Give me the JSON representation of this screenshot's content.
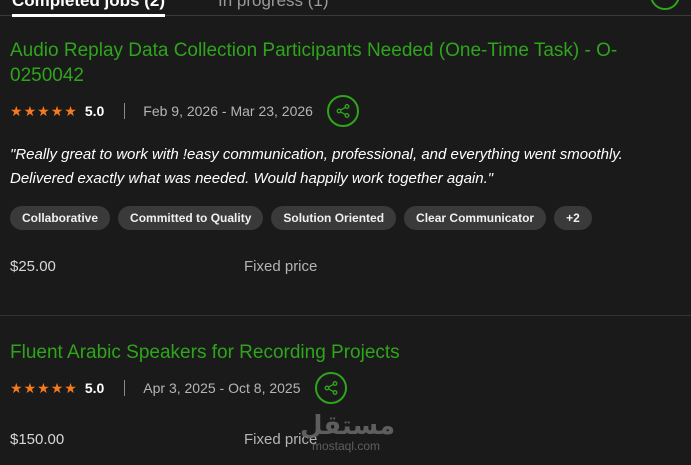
{
  "tabs": [
    {
      "label": "Completed jobs (2)",
      "active": true
    },
    {
      "label": "In progress (1)",
      "active": false
    }
  ],
  "colors": {
    "accent": "#2ea51b",
    "star": "#f57a1e",
    "background": "#1a1a1a"
  },
  "jobs": [
    {
      "title": "Audio Replay Data Collection Participants Needed (One-Time Task) - O-0250042",
      "rating": "5.0",
      "stars": 5,
      "dates": "Feb 9, 2026 - Mar 23, 2026",
      "review": "\"Really great to work with !easy communication, professional, and everything went smoothly. Delivered exactly what was needed. Would happily work together again.\"",
      "skills": [
        "Collaborative",
        "Committed to Quality",
        "Solution Oriented",
        "Clear Communicator",
        "+2"
      ],
      "price": "$25.00",
      "price_type": "Fixed price"
    },
    {
      "title": "Fluent Arabic Speakers for Recording Projects",
      "rating": "5.0",
      "stars": 5,
      "dates": "Apr 3, 2025 - Oct 8, 2025",
      "price": "$150.00",
      "price_type": "Fixed price"
    }
  ],
  "watermark": {
    "arabic": "مستقل",
    "latin": "mostaql.com"
  },
  "icons": {
    "star": "star-icon",
    "share": "share-icon"
  }
}
